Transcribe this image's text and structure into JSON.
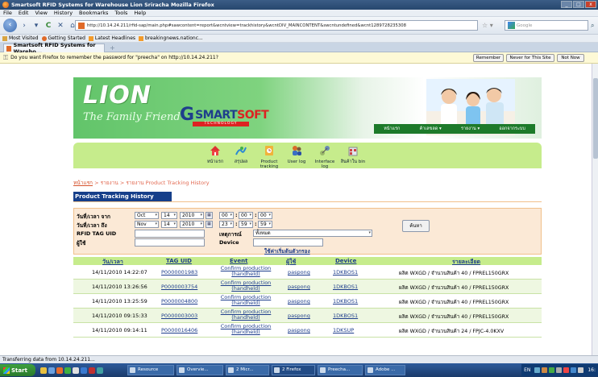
{
  "window": {
    "title": "Smartsoft RFID Systems for Warehouse  Lion Sriracha  Mozilla Firefox",
    "controls": [
      "_",
      "□",
      "x"
    ]
  },
  "menubar": [
    "File",
    "Edit",
    "View",
    "History",
    "Bookmarks",
    "Tools",
    "Help"
  ],
  "navbar": {
    "url": "http://10.14.24.211/rfid-sap/main.php#sawcontent=report&wcntview=trackhistory&wcntDIV_MAINCONTENT&swcntundefined&wcnt1289728235308",
    "search_placeholder": "Google"
  },
  "bookmarks": [
    "Most Visited",
    "Getting Started",
    "Latest Headlines",
    "breakingnews.nationc..."
  ],
  "tab": {
    "label": "Smartsoft RFID Systems for Wareho...",
    "new_tab": "+"
  },
  "password_bar": {
    "message": "Do you want Firefox to remember the password for \"preecha\" on http://10.14.24.211?",
    "remember": "Remember",
    "never": "Never for This Site",
    "not_now": "Not Now"
  },
  "header": {
    "logo_word": "LION",
    "logo_tagline": "The Family Friend",
    "brand_mark": "G",
    "brand_smart": "SMART",
    "brand_soft": "SOFT",
    "brand_sub": "TECHNOLOGY",
    "top_menu": [
      "หน้าแรก",
      "ค้าเลขลด ▾",
      "รายงาน ▾",
      "ออกจากระบบ"
    ]
  },
  "iconbar": [
    {
      "label": "หน้าแรก",
      "icon": "home-icon",
      "color": "#d33"
    },
    {
      "label": "สรุปผล",
      "icon": "summary-icon",
      "color": "#2a8ad4"
    },
    {
      "label": "Product\ntracking",
      "icon": "product-tracking-icon",
      "color": "#e89b1a"
    },
    {
      "label": "User log",
      "icon": "user-log-icon",
      "color": "#3a6fc4"
    },
    {
      "label": "Interface\nlog",
      "icon": "interface-log-icon",
      "color": "#7a9a4a"
    },
    {
      "label": "สินค้าใน bin",
      "icon": "bin-icon",
      "color": "#c44"
    }
  ],
  "breadcrumb": {
    "home": "หน้าแรก",
    "rest": " > รายงาน > รายงาน Product Tracking History"
  },
  "section_title": "Product Tracking History",
  "filter": {
    "from_label": "วันที่/เวลา จาก",
    "to_label": "วันที่/เวลา ถึง",
    "tag_label": "RFID TAG UID",
    "user_label": "ผู้ใช้",
    "event_label": "เหตุการณ์",
    "device_label": "Device",
    "from": {
      "month": "Oct",
      "day": "14",
      "year": "2010",
      "hh": "00",
      "mm": "00",
      "ss": "00"
    },
    "to": {
      "month": "Nov",
      "day": "14",
      "year": "2010",
      "hh": "23",
      "mm": "59",
      "ss": "59"
    },
    "event_value": "ทั้งหมด",
    "search_button": "ค้นหา",
    "reset_link": "ใช้ค่าเริ่มต้นตัวกรอง"
  },
  "table": {
    "columns": [
      "วัน/เวลา",
      "TAG UID",
      "Event",
      "ผู้ใช้",
      "Device",
      "รายละเอียด"
    ],
    "rows": [
      {
        "datetime": "14/11/2010 14:22:07",
        "tag": "P0000001983",
        "event": "Confirm production (handheld)",
        "user": "paspong",
        "device": "1DKBOS1",
        "detail": "ผลิต WXGD / จำนวนสินค้า 40 / FPREL150GRX"
      },
      {
        "datetime": "14/11/2010 13:26:56",
        "tag": "P0000003754",
        "event": "Confirm production (handheld)",
        "user": "paspong",
        "device": "1DKBOS1",
        "detail": "ผลิต WXGD / จำนวนสินค้า 40 / FPREL150GRX"
      },
      {
        "datetime": "14/11/2010 13:25:59",
        "tag": "P0000004800",
        "event": "Confirm production (handheld)",
        "user": "paspong",
        "device": "1DKBOS1",
        "detail": "ผลิต WXGD / จำนวนสินค้า 40 / FPREL150GRX"
      },
      {
        "datetime": "14/11/2010 09:15:33",
        "tag": "P0000003003",
        "event": "Confirm production (handheld)",
        "user": "paspong",
        "device": "1DKBOS1",
        "detail": "ผลิต WXGD / จำนวนสินค้า 40 / FPREL150GRX"
      },
      {
        "datetime": "14/11/2010 09:14:11",
        "tag": "P0000016406",
        "event": "Confirm production (handheld)",
        "user": "paspong",
        "device": "1DKSUP",
        "detail": "ผลิต WXGD / จำนวนสินค้า 24 / FPJC-4.0KXV"
      }
    ]
  },
  "status": "Transferring data from 10.14.24.211...",
  "taskbar": {
    "start": "Start",
    "buttons": [
      "Resource",
      "Overvie...",
      "2 Micr...",
      "2 Firefox",
      "Preecha...",
      "Adobe ..."
    ],
    "lang": "EN",
    "clock": "16:"
  }
}
